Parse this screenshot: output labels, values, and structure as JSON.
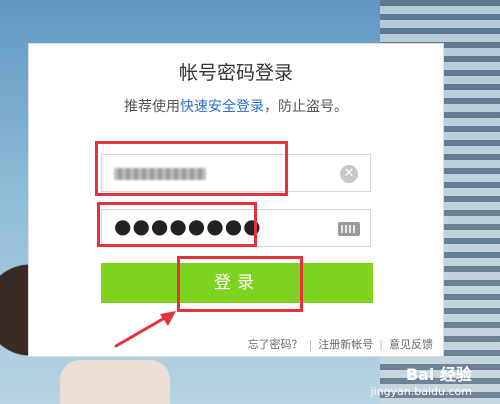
{
  "dialog": {
    "title": "帐号密码登录",
    "subtitle_prefix": "推荐使用",
    "subtitle_link": "快速安全登录",
    "subtitle_suffix": "，防止盗号。",
    "username_value": "xxxxxxxx",
    "password_value": "●●●●●●●●",
    "clear_icon_glyph": "✕",
    "login_button": "登录",
    "footer": {
      "forgot": "忘了密码？",
      "register": "注册新帐号",
      "feedback": "意见反馈",
      "separator": "|"
    }
  },
  "colors": {
    "accent_green": "#7ed321",
    "link_blue": "#2a6fcc",
    "annotation_red": "#e6323c"
  },
  "watermark": {
    "brand": "Bai 经验",
    "url": "jingyan.baidu.com"
  }
}
